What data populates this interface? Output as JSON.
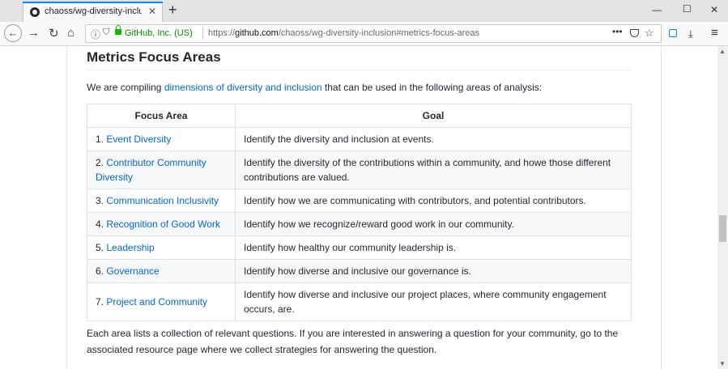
{
  "browser": {
    "tab_title": "chaoss/wg-diversity-inclusion: ...",
    "identity": "GitHub, Inc. (US)",
    "url_prefix": "https://",
    "url_domain": "github.com",
    "url_path": "/chaoss/wg-diversity-inclusion#metrics-focus-areas",
    "more_label": "•••"
  },
  "page": {
    "heading": "Metrics Focus Areas",
    "intro_before": "We are compiling ",
    "intro_link": "dimensions of diversity and inclusion",
    "intro_after": " that can be used in the following areas of analysis:",
    "table": {
      "headers": [
        "Focus Area",
        "Goal"
      ],
      "rows": [
        {
          "num": "1. ",
          "area": "Event Diversity",
          "goal": "Identify the diversity and inclusion at events."
        },
        {
          "num": "2. ",
          "area": "Contributor Community Diversity",
          "goal": "Identify the diversity of the contributions within a community, and howe those different contributions are valued."
        },
        {
          "num": "3. ",
          "area": "Communication Inclusivity",
          "goal": "Identify how we are communicating with contributors, and potential contributors."
        },
        {
          "num": "4. ",
          "area": "Recognition of Good Work",
          "goal": "Identify how we recognize/reward good work in our community."
        },
        {
          "num": "5. ",
          "area": "Leadership",
          "goal": "Identify how healthy our community leadership is."
        },
        {
          "num": "6. ",
          "area": "Governance",
          "goal": "Identify how diverse and inclusive our governance is."
        },
        {
          "num": "7. ",
          "area": "Project and Community",
          "goal": "Identify how diverse and inclusive our project places, where community engagement occurs, are."
        }
      ]
    },
    "outro": "Each area lists a collection of relevant questions. If you are interested in answering a question for your community, go to the associated resource page where we collect strategies for answering the question."
  },
  "colors": {
    "link": "#0366d6",
    "accent": "#0a84ff",
    "secure": "#12bc00"
  }
}
